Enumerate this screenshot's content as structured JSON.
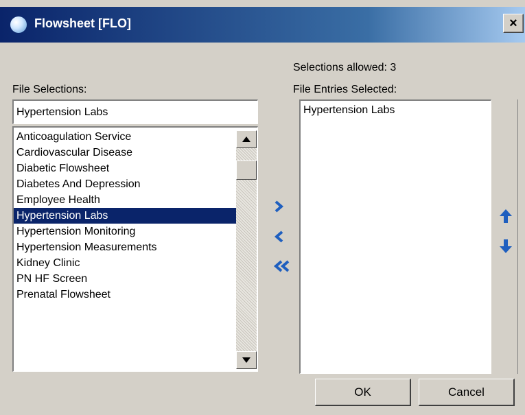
{
  "window": {
    "title": "Flowsheet [FLO]",
    "close_label": "×"
  },
  "selections_allowed_text": "Selections allowed:  3",
  "file_selections": {
    "label": "File Selections:",
    "search_value": "Hypertension Labs",
    "items": [
      "Anticoagulation Service",
      "Cardiovascular Disease",
      "Diabetic Flowsheet",
      "Diabetes And Depression",
      "Employee Health",
      "Hypertension Labs",
      "Hypertension Monitoring",
      "Hypertension Measurements",
      "Kidney Clinic",
      "PN HF Screen",
      "Prenatal Flowsheet"
    ],
    "selected_item": "Hypertension Labs"
  },
  "file_entries_selected": {
    "label": "File Entries Selected:",
    "items": [
      "Hypertension Labs"
    ]
  },
  "buttons": {
    "ok_label": "OK",
    "cancel_label": "Cancel"
  },
  "icons": {
    "add": "chevron-right-icon",
    "remove": "chevron-left-icon",
    "remove_all": "double-chevron-left-icon",
    "move_up": "arrow-up-icon",
    "move_down": "arrow-down-icon"
  },
  "colors": {
    "accent_blue": "#1f5fbf",
    "selection": "#0a246a",
    "titlebar": "#0a246a"
  }
}
